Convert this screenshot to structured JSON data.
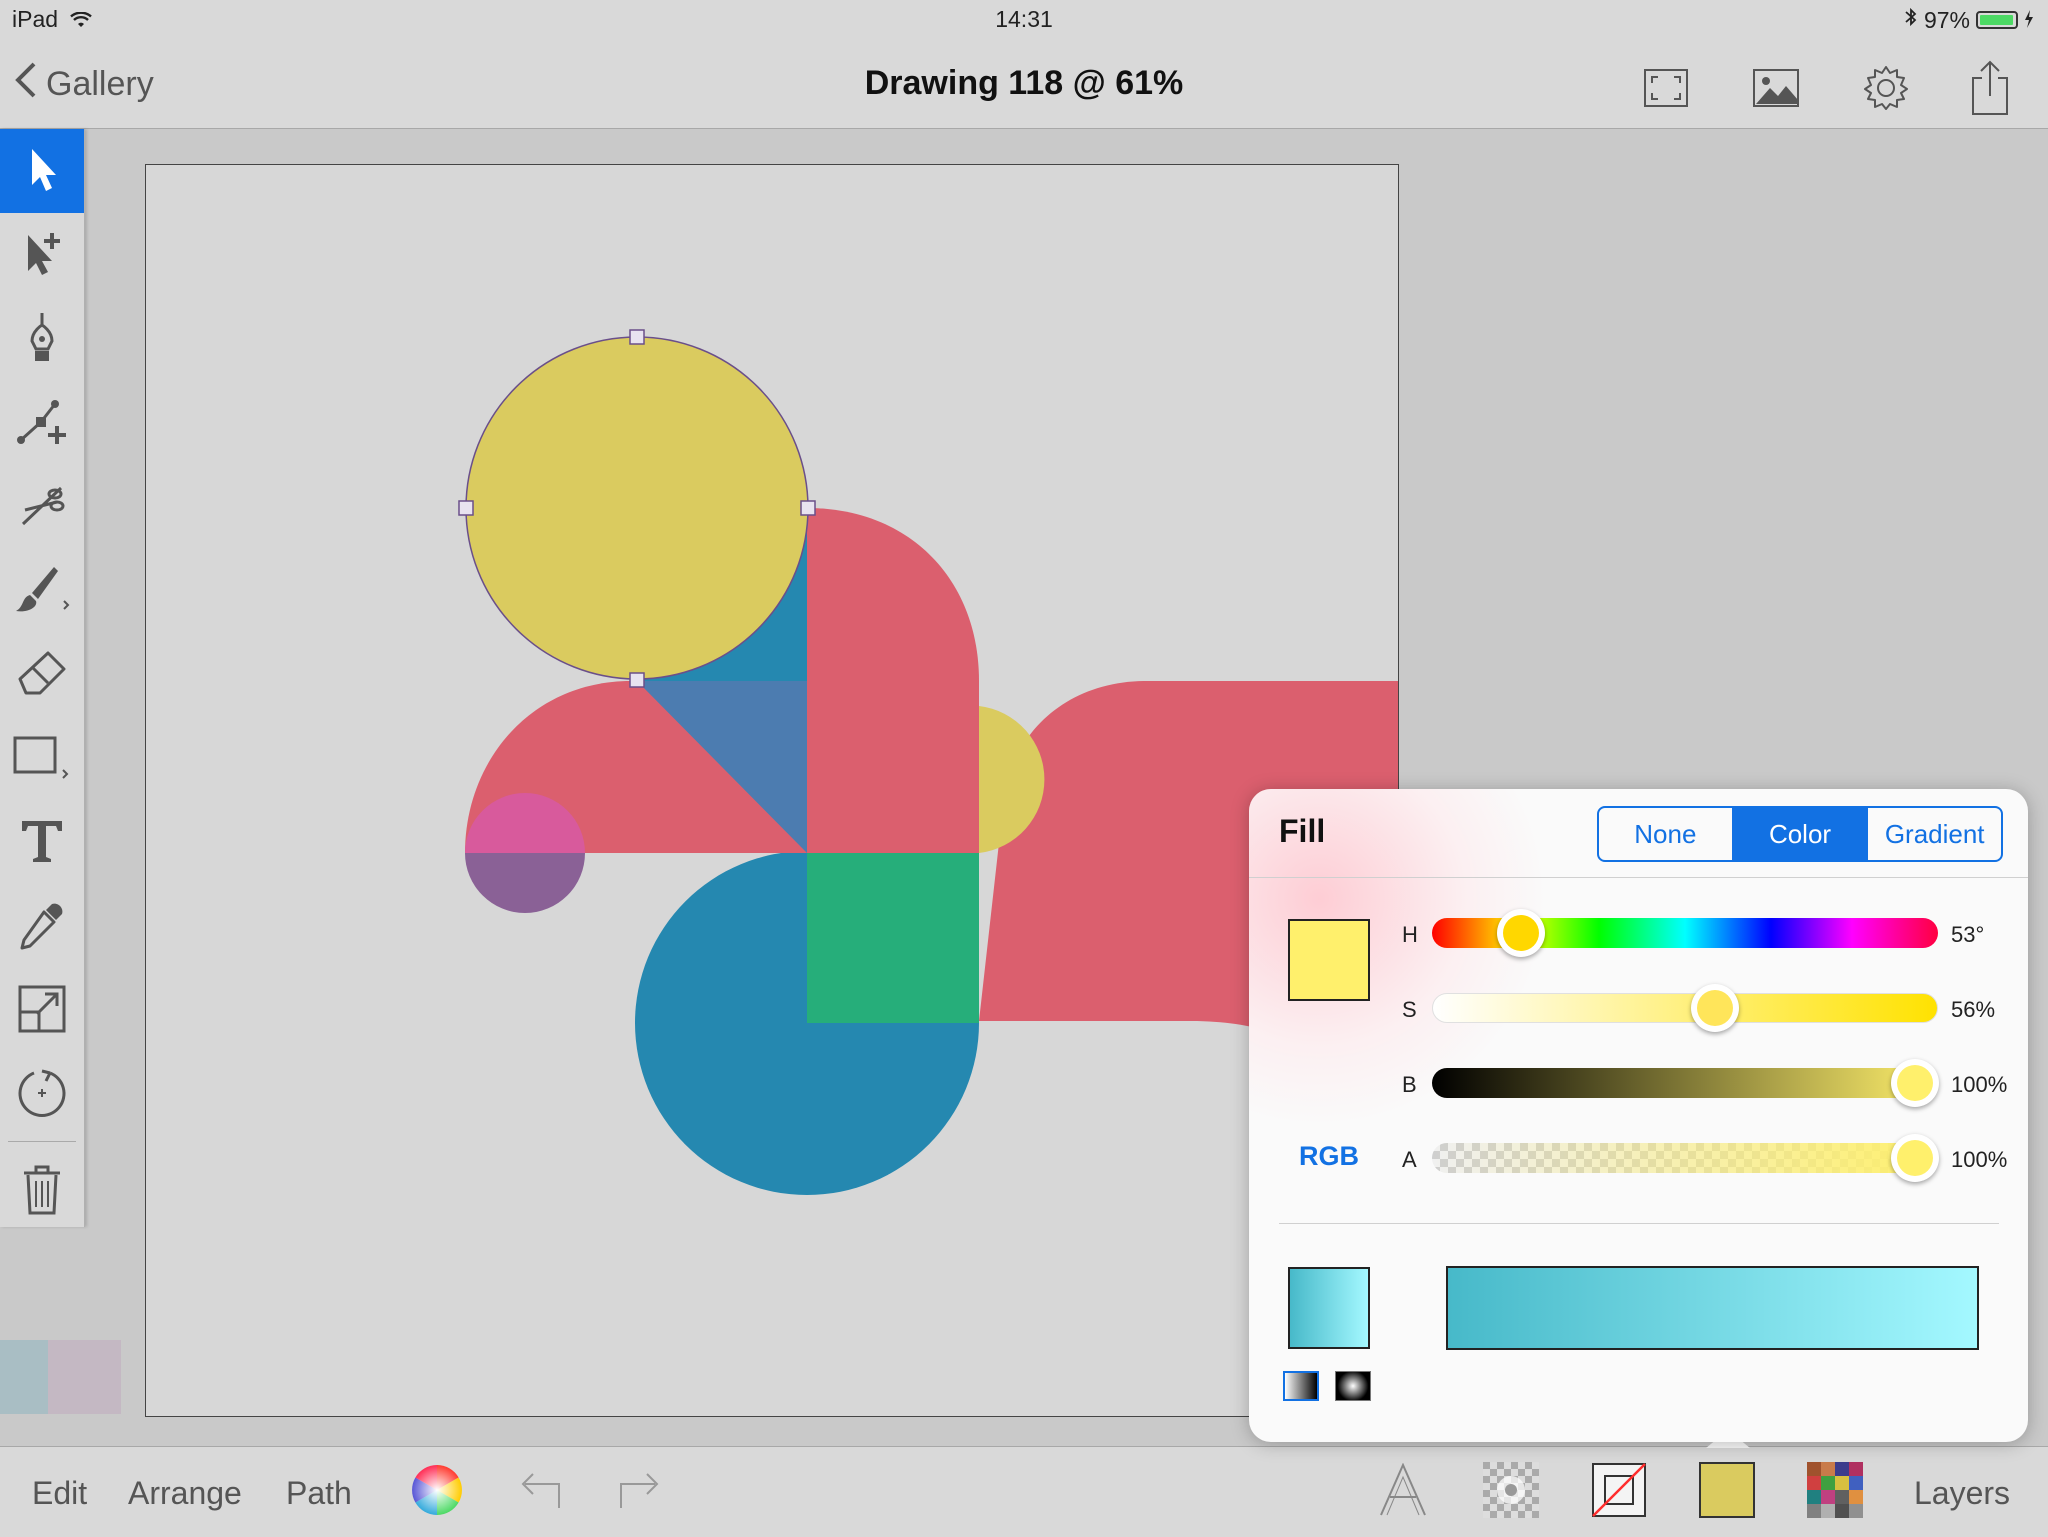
{
  "status": {
    "device": "iPad",
    "time": "14:31",
    "battery": "97%",
    "battery_level": 0.97
  },
  "nav": {
    "back_label": "Gallery",
    "title": "Drawing 118 @ 61%"
  },
  "icons": {
    "nav_right": [
      "fullscreen-icon",
      "image-icon",
      "gear-icon",
      "share-icon"
    ],
    "tools": [
      "select-arrow-icon",
      "direct-select-icon",
      "pen-icon",
      "node-icon",
      "scissors-icon",
      "brush-icon",
      "eraser-icon",
      "rectangle-icon",
      "text-icon",
      "eyedropper-icon",
      "transform-icon",
      "rotate-icon",
      "trash-icon"
    ]
  },
  "history_swatches": [
    "#a9bec4",
    "#c4b8c3"
  ],
  "bottom": {
    "edit": "Edit",
    "arrange": "Arrange",
    "path": "Path",
    "layers": "Layers"
  },
  "fill_popover": {
    "title": "Fill",
    "modes": [
      "None",
      "Color",
      "Gradient"
    ],
    "selected_mode": "Color",
    "current_color": "#fff06c",
    "color_model": "RGB",
    "sliders": [
      {
        "label": "H",
        "value": "53°",
        "position": 0.175,
        "knob_color": "#ffd700"
      },
      {
        "label": "S",
        "value": "56%",
        "position": 0.56,
        "knob_color": "#ffe55a"
      },
      {
        "label": "B",
        "value": "100%",
        "position": 0.955,
        "knob_color": "#fff06c"
      },
      {
        "label": "A",
        "value": "100%",
        "position": 0.955,
        "knob_color": "#fff06c"
      }
    ],
    "gradient": {
      "from": "#47b9c9",
      "to": "#a4f8ff"
    }
  },
  "colors": {
    "accent": "#1271e3",
    "yellow": "#dacb5f",
    "red": "#db5f6e",
    "blue": "#2588b0",
    "green": "#26ae7a",
    "steel": "#4c7cb0",
    "pink": "#d85a9c",
    "purple": "#8a6196"
  }
}
